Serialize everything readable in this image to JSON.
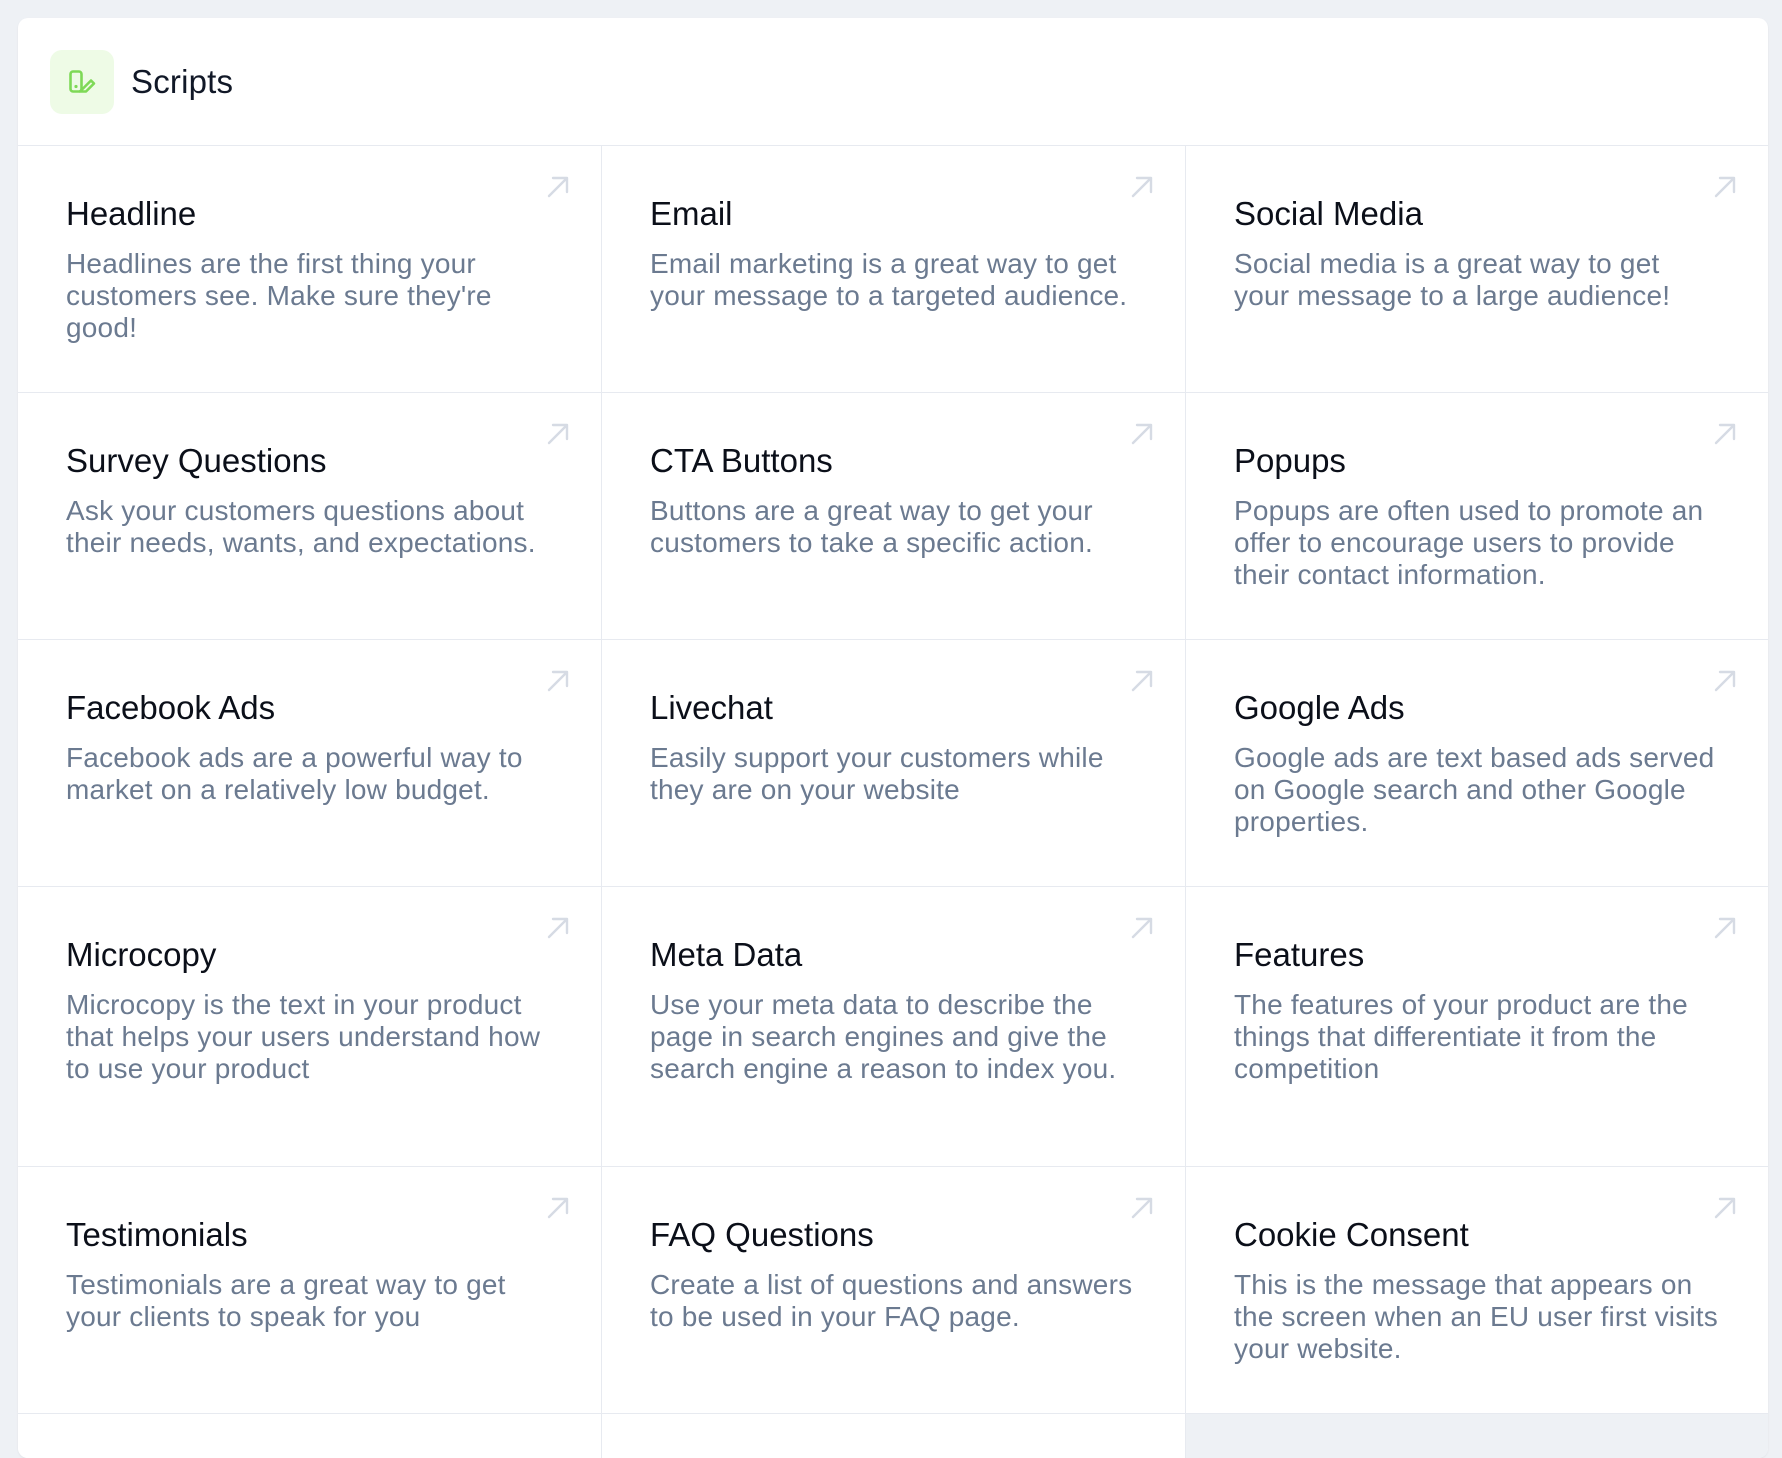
{
  "header": {
    "title": "Scripts",
    "icon": "scripts-icon",
    "accent": "#7ed957",
    "icon_bg": "#eefbe6"
  },
  "cards": [
    {
      "title": "Headline",
      "description": "Headlines are the first thing your customers see. Make sure they're good!"
    },
    {
      "title": "Email",
      "description": "Email marketing is a great way to get your message to a targeted audience."
    },
    {
      "title": "Social Media",
      "description": "Social media is a great way to get your message to a large audience!"
    },
    {
      "title": "Survey Questions",
      "description": "Ask your customers questions about their needs, wants, and expectations."
    },
    {
      "title": "CTA Buttons",
      "description": "Buttons are a great way to get your customers to take a specific action."
    },
    {
      "title": "Popups",
      "description": "Popups are often used to promote an offer to encourage users to provide their contact information."
    },
    {
      "title": "Facebook Ads",
      "description": "Facebook ads are a powerful way to market on a relatively low budget."
    },
    {
      "title": "Livechat",
      "description": "Easily support your customers while they are on your website"
    },
    {
      "title": "Google Ads",
      "description": "Google ads are text based ads served on Google search and other Google properties."
    },
    {
      "title": "Microcopy",
      "description": "Microcopy is the text in your product that helps your users understand how to use your product"
    },
    {
      "title": "Meta Data",
      "description": "Use your meta data to describe the page in search engines and give the search engine a reason to index you."
    },
    {
      "title": "Features",
      "description": "The features of your product are the things that differentiate it from the competition"
    },
    {
      "title": "Testimonials",
      "description": "Testimonials are a great way to get your clients to speak for you"
    },
    {
      "title": "FAQ Questions",
      "description": "Create a list of questions and answers to be used in your FAQ page."
    },
    {
      "title": "Cookie Consent",
      "description": "This is the message that appears on the screen when an EU user first visits your website."
    }
  ],
  "card_icon": "arrow-up-right-icon",
  "colors": {
    "title": "#0b0f19",
    "description": "#6b7a90",
    "border": "#e7eaf0",
    "arrow": "#d6dbe4",
    "background": "#eef1f5"
  }
}
